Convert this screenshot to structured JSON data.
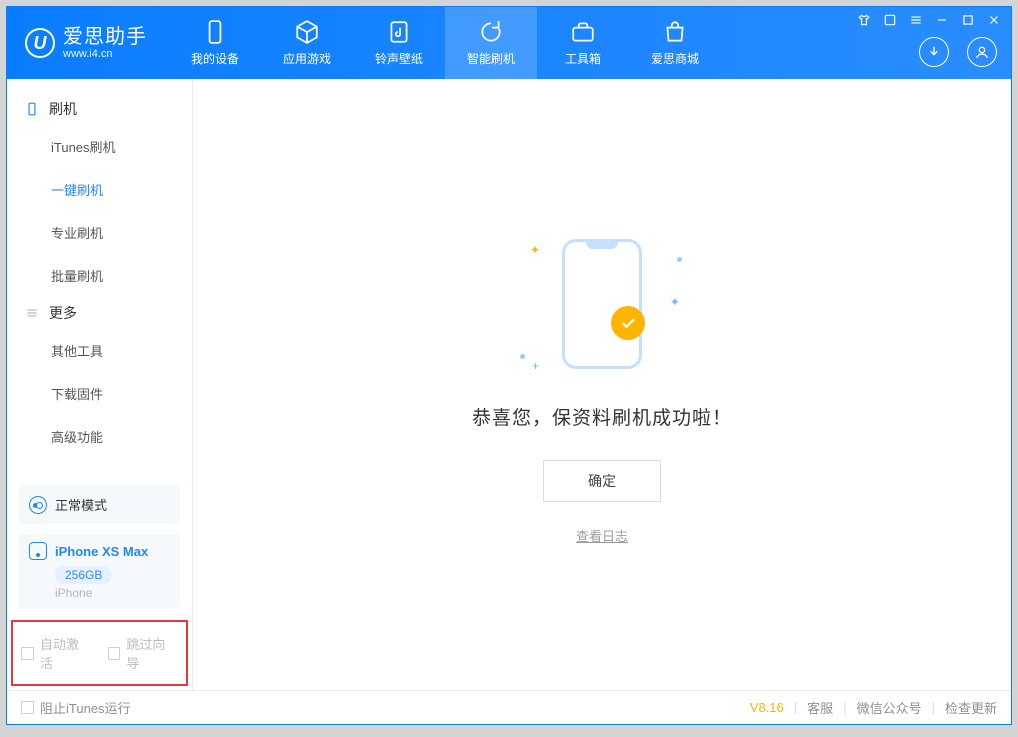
{
  "app": {
    "name_cn": "爱思助手",
    "site_url": "www.i4.cn"
  },
  "tabs": {
    "device": "我的设备",
    "apps": "应用游戏",
    "ring": "铃声壁纸",
    "flash": "智能刷机",
    "tool": "工具箱",
    "store": "爱思商城"
  },
  "sidebar": {
    "group_flash": "刷机",
    "items_flash": {
      "itunes": "iTunes刷机",
      "onekey": "一键刷机",
      "pro": "专业刷机",
      "batch": "批量刷机"
    },
    "group_more": "更多",
    "items_more": {
      "other": "其他工具",
      "fw": "下载固件",
      "adv": "高级功能"
    }
  },
  "mode": {
    "label": "正常模式"
  },
  "device": {
    "name": "iPhone XS Max",
    "capacity": "256GB",
    "type": "iPhone"
  },
  "checks": {
    "auto_activate": "自动激活",
    "skip_wizard": "跳过向导"
  },
  "main": {
    "success": "恭喜您，保资料刷机成功啦！",
    "ok": "确定",
    "view_log": "查看日志"
  },
  "footer": {
    "block_itunes": "阻止iTunes运行",
    "version": "V8.16",
    "cs": "客服",
    "wechat": "微信公众号",
    "update": "检查更新"
  }
}
